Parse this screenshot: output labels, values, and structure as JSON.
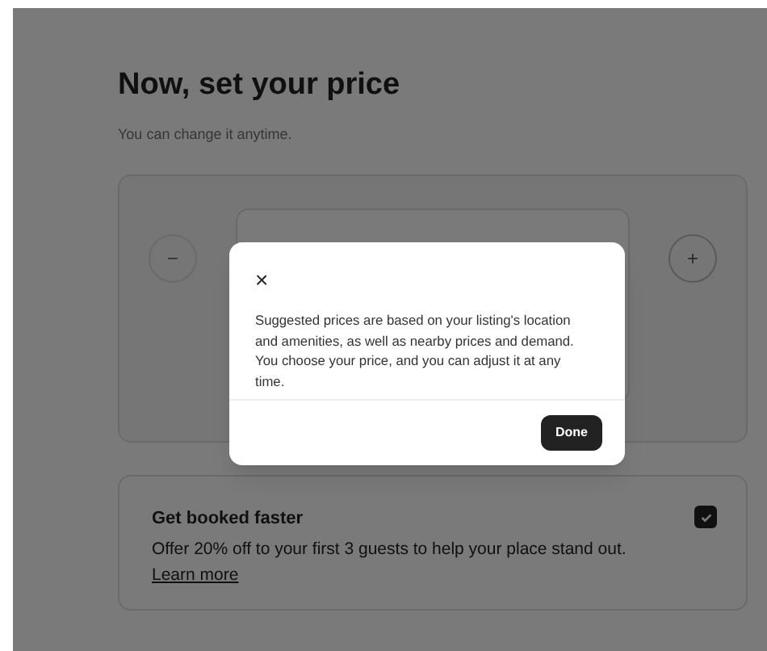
{
  "page": {
    "title": "Now, set your price",
    "subtitle": "You can change it anytime.",
    "price_card": {
      "decrease": "−",
      "increase": "+"
    },
    "promo": {
      "title": "Get booked faster",
      "text": "Offer 20% off to your first 3 guests to help your place stand out.",
      "link": "Learn more",
      "checked": true
    }
  },
  "dialog": {
    "close": "×",
    "text": "Suggested prices are based on your listing's location and amenities, as well as nearby prices and demand. You choose your price, and you can adjust it at any time.",
    "button": "Done"
  }
}
